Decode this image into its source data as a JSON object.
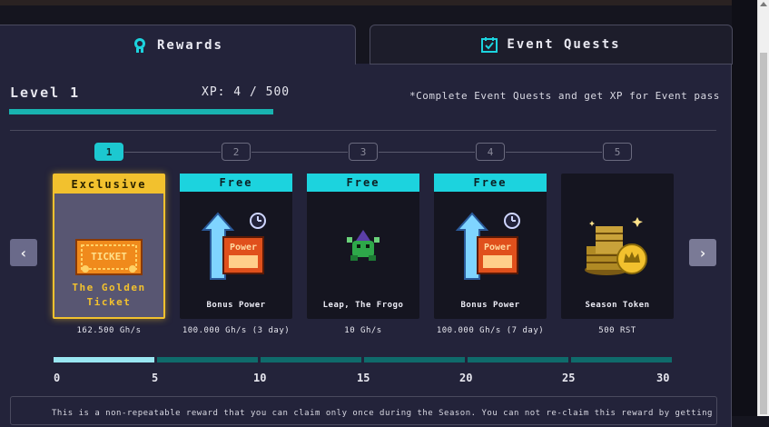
{
  "tabs": {
    "rewards": "Rewards",
    "quests": "Event Quests"
  },
  "level": {
    "label": "Level 1",
    "xp_text": "XP: 4 / 500",
    "xp_progress": 1.0,
    "note": "*Complete Event Quests and get XP for Event pass"
  },
  "steps": [
    "1",
    "2",
    "3",
    "4",
    "5"
  ],
  "rewards": [
    {
      "badge": "Exclusive",
      "name": "The Golden Ticket",
      "value": "162.500 Gh/s"
    },
    {
      "badge": "Free",
      "name": "Bonus Power",
      "value": "100.000 Gh/s (3 day)"
    },
    {
      "badge": "Free",
      "name": "Leap, The Frogo",
      "value": "10 Gh/s"
    },
    {
      "badge": "Free",
      "name": "Bonus Power",
      "value": "100.000 Gh/s (7 day)"
    },
    {
      "badge": "",
      "name": "Season Token",
      "value": "500 RST"
    }
  ],
  "progress": {
    "ticks": [
      "0",
      "5",
      "10",
      "15",
      "20",
      "25",
      "30"
    ],
    "completed_segments": 1
  },
  "footer_text": "This is a non-repeatable reward that you can claim only once during the Season. You can not re-claim this reward by getting all",
  "colors": {
    "accent": "#1cd3de",
    "gold": "#f2c12e",
    "panel": "#23233a"
  },
  "icons": {
    "prev": "‹",
    "next": "›"
  }
}
